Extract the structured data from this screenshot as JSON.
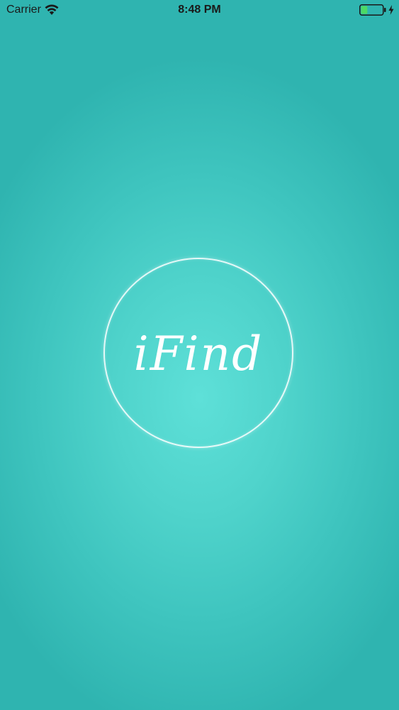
{
  "status_bar": {
    "carrier": "Carrier",
    "time": "8:48 PM",
    "icons": {
      "wifi": "wifi-icon",
      "battery": "battery-icon",
      "charging": "bolt-icon"
    },
    "battery_level": 0.3,
    "battery_color": "#4cd964"
  },
  "splash": {
    "logo_text": "iFind",
    "colors": {
      "background_center": "#5ee0d8",
      "background_edge": "#2fb4b0",
      "ring": "#ffffff"
    }
  }
}
